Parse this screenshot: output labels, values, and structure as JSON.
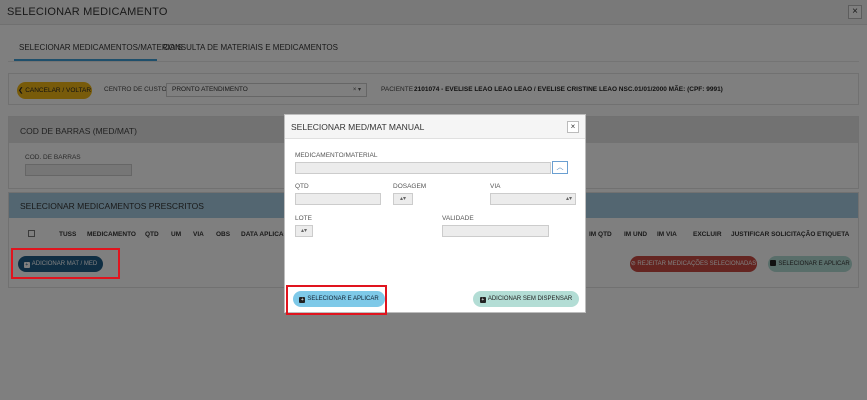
{
  "window": {
    "title": "SELECIONAR MEDICAMENTO",
    "close": "×"
  },
  "tabs": [
    {
      "label": "SELECIONAR MEDICAMENTOS/MATERIAIS"
    },
    {
      "label": "CONSULTA DE MATERIAIS E MEDICAMENTOS"
    }
  ],
  "toolbar": {
    "cancel_label": "CANCELAR / VOLTAR",
    "centro_label": "CENTRO DE CUSTOS",
    "centro_value": "PRONTO ATENDIMENTO",
    "paciente_label": "PACIENTE",
    "paciente_value": "2101074 - EVELISE LEAO LEAO LEAO / EVELISE CRISTINE LEAO NSC.01/01/2000 MÃE: (CPF: 9991)"
  },
  "barcode": {
    "title": "COD DE BARRAS (MED/MAT)",
    "field_label": "COD. DE BARRAS"
  },
  "prescribed": {
    "title": "SELECIONAR MEDICAMENTOS PRESCRITOS",
    "columns": [
      "TUSS",
      "MEDICAMENTO",
      "QTD",
      "UM",
      "VIA",
      "OBS",
      "DATA APLICAÇÃ",
      "IM QTD",
      "IM UND",
      "IM VIA",
      "EXCLUIR",
      "JUSTIFICAR SOLICITAÇÃO",
      "ETIQUETA"
    ],
    "add_label": "ADICIONAR MAT / MED",
    "reject_label": "REJEITAR MEDICAÇÕES SELECIONADAS",
    "apply_label": "SELECIONAR E APLICAR"
  },
  "modal": {
    "title": "SELECIONAR MED/MAT MANUAL",
    "close": "×",
    "medicamento_label": "MEDICAMENTO/MATERIAL",
    "qtd_label": "QTD",
    "dosagem_label": "DOSAGEM",
    "via_label": "VIA",
    "lote_label": "LOTE",
    "validade_label": "VALIDADE",
    "select_apply_label": "SELECIONAR E APLICAR",
    "add_no_dispense_label": "ADICIONAR SEM DISPENSAR"
  }
}
